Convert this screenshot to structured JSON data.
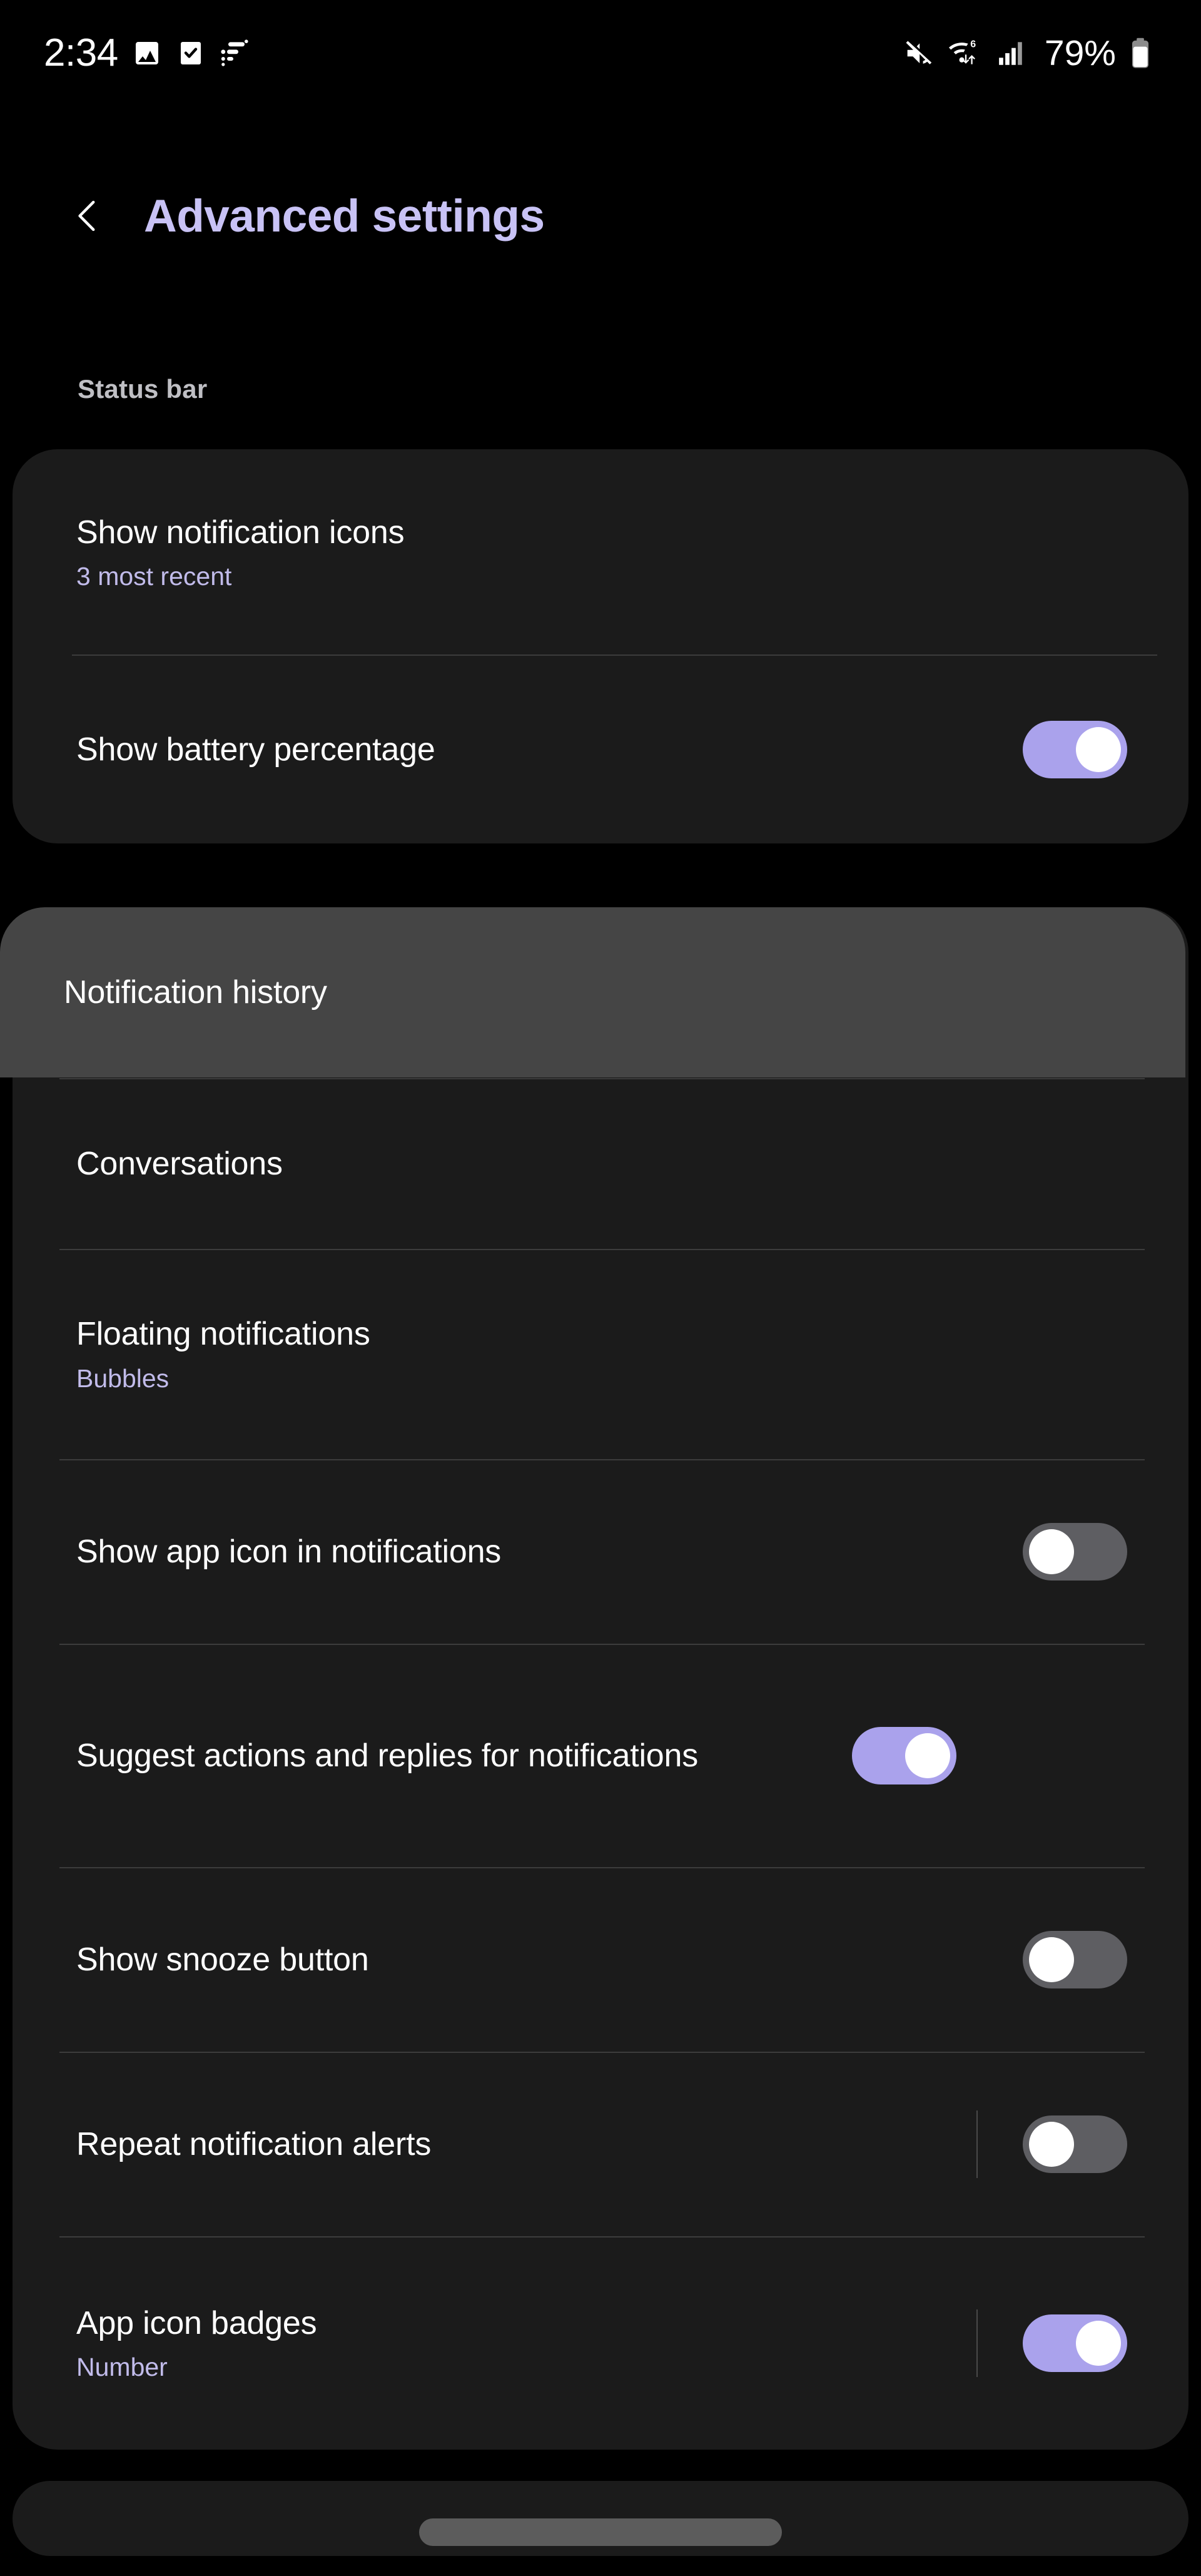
{
  "status_bar": {
    "clock": "2:34",
    "battery_percent": "79%",
    "left_icons": [
      "image-icon",
      "checkbox-icon",
      "filter-list-icon"
    ],
    "right_icons": [
      "mute-icon",
      "wifi-6-data-icon",
      "cellular-signal-icon",
      "battery-icon"
    ],
    "wifi_generation": "6"
  },
  "header": {
    "back_icon": "chevron-left-icon",
    "title": "Advanced settings",
    "title_color": "#c8c2f5"
  },
  "sections": [
    {
      "label": "Status bar",
      "rows": [
        {
          "title": "Show notification icons",
          "subtitle": "3 most recent",
          "control": "none"
        },
        {
          "title": "Show battery percentage",
          "subtitle": "",
          "control": "toggle",
          "toggle_state": "on"
        }
      ]
    },
    {
      "label": "",
      "rows": [
        {
          "title": "Notification history",
          "subtitle": "",
          "control": "none",
          "highlighted": true
        },
        {
          "title": "Conversations",
          "subtitle": "",
          "control": "none"
        },
        {
          "title": "Floating notifications",
          "subtitle": "Bubbles",
          "control": "none"
        },
        {
          "title": "Show app icon in notifications",
          "subtitle": "",
          "control": "toggle",
          "toggle_state": "off"
        },
        {
          "title": "Suggest actions and replies for notifications",
          "subtitle": "",
          "control": "toggle",
          "toggle_state": "on"
        },
        {
          "title": "Show snooze button",
          "subtitle": "",
          "control": "toggle",
          "toggle_state": "off"
        },
        {
          "title": "Repeat notification alerts",
          "subtitle": "",
          "control": "toggle-with-separator",
          "toggle_state": "off"
        },
        {
          "title": "App icon badges",
          "subtitle": "Number",
          "control": "toggle-with-separator",
          "toggle_state": "on"
        }
      ]
    }
  ],
  "colors": {
    "page_background": "#000000",
    "card_background": "#1b1b1b",
    "highlight_background": "#454545",
    "accent_purple": "#aaa2ec",
    "title_purple": "#c8c2f5",
    "subtitle_purple": "#c1bbea",
    "toggle_off": "#5e5e62",
    "divider": "#3c3c3c",
    "section_label": "#bfbfc4"
  },
  "navigation": {
    "gesture_pill": "home-gesture-pill"
  }
}
